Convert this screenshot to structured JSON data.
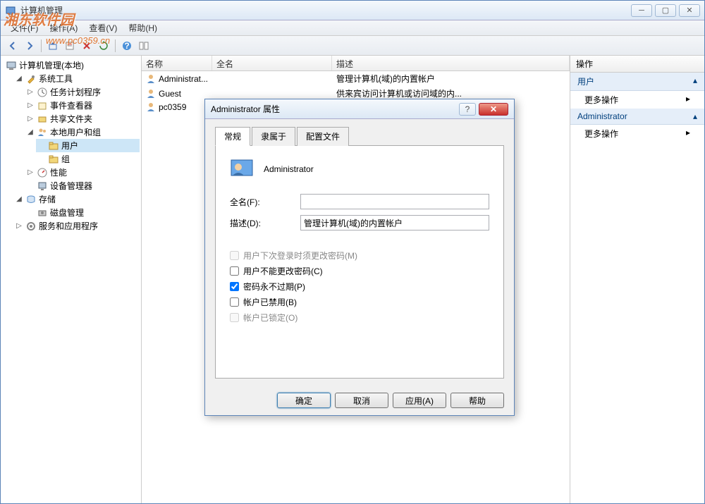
{
  "watermark": {
    "brand": "湘东软件园",
    "url": "www.pc0359.cn"
  },
  "window": {
    "title": "计算机管理",
    "menu": {
      "file": "文件(F)",
      "action": "操作(A)",
      "view": "查看(V)",
      "help": "帮助(H)"
    }
  },
  "tree": {
    "root": "计算机管理(本地)",
    "system_tools": "系统工具",
    "task_scheduler": "任务计划程序",
    "event_viewer": "事件查看器",
    "shared_folders": "共享文件夹",
    "local_users": "本地用户和组",
    "users": "用户",
    "groups": "组",
    "performance": "性能",
    "device_manager": "设备管理器",
    "storage": "存储",
    "disk_mgmt": "磁盘管理",
    "services_apps": "服务和应用程序"
  },
  "list": {
    "headers": {
      "name": "名称",
      "fullname": "全名",
      "desc": "描述"
    },
    "rows": [
      {
        "name": "Administrat...",
        "fullname": "",
        "desc": "管理计算机(域)的内置帐户"
      },
      {
        "name": "Guest",
        "fullname": "",
        "desc": "供来宾访问计算机或访问域的内..."
      },
      {
        "name": "pc0359",
        "fullname": "",
        "desc": ""
      }
    ]
  },
  "actions": {
    "header": "操作",
    "section1": "用户",
    "more1": "更多操作",
    "section2": "Administrator",
    "more2": "更多操作"
  },
  "dialog": {
    "title": "Administrator 属性",
    "tabs": {
      "general": "常规",
      "member": "隶属于",
      "profile": "配置文件"
    },
    "username": "Administrator",
    "labels": {
      "fullname": "全名(F):",
      "desc": "描述(D):"
    },
    "fields": {
      "fullname": "",
      "desc": "管理计算机(域)的内置帐户"
    },
    "checks": {
      "must_change": "用户下次登录时须更改密码(M)",
      "cannot_change": "用户不能更改密码(C)",
      "never_expire": "密码永不过期(P)",
      "disabled": "帐户已禁用(B)",
      "locked": "帐户已锁定(O)"
    },
    "buttons": {
      "ok": "确定",
      "cancel": "取消",
      "apply": "应用(A)",
      "help": "帮助"
    }
  }
}
